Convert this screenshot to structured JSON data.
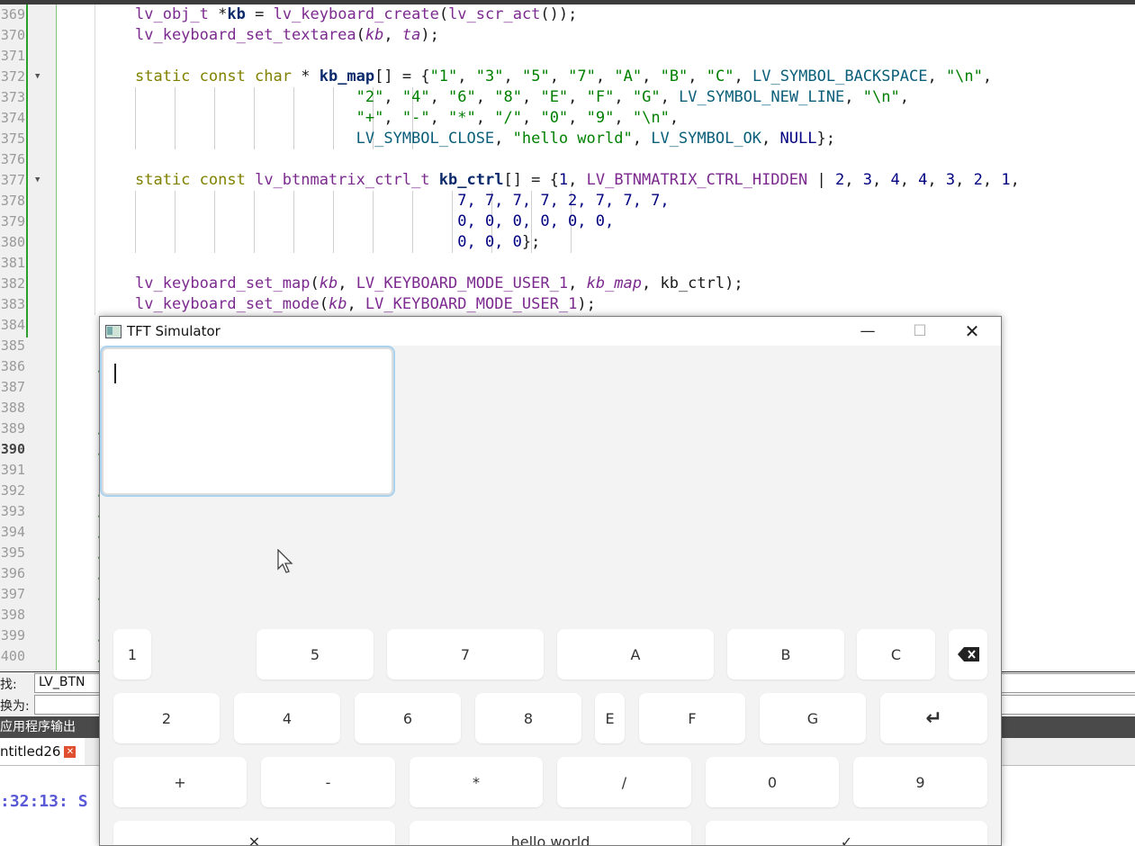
{
  "editor": {
    "line_numbers": [
      "369",
      "370",
      "371",
      "372",
      "373",
      "374",
      "375",
      "376",
      "377",
      "378",
      "379",
      "380",
      "381",
      "382",
      "383",
      "384",
      "385",
      "386",
      "387",
      "388",
      "389",
      "390",
      "391",
      "392",
      "393",
      "394",
      "395",
      "396",
      "397",
      "398",
      "399",
      "400"
    ],
    "current_line": "390",
    "fold_icon": "collapse-triangle"
  },
  "find": {
    "find_label": "找:",
    "find_value": "LV_BTN",
    "replace_label": "换为:"
  },
  "output": {
    "panel_title": "应用程序输出",
    "tab_label": "ntitled26",
    "text": ":32:13: S"
  },
  "simulator": {
    "title": "TFT Simulator",
    "min_icon": "minimize-icon",
    "max_icon": "maximize-icon",
    "close_icon": "close-icon",
    "keys": {
      "k1": "1",
      "k5": "5",
      "k7": "7",
      "kA": "A",
      "kB": "B",
      "kC": "C",
      "kbs": "⌫",
      "k2": "2",
      "k4": "4",
      "k6": "6",
      "k8": "8",
      "kE": "E",
      "kF": "F",
      "kG": "G",
      "knl": "↵",
      "kplus": "+",
      "kminus": "-",
      "kstar": "*",
      "kslash": "/",
      "k0": "0",
      "k9": "9",
      "kclose": "✕",
      "khello": "hello world",
      "kok": "✓"
    }
  },
  "colors": {
    "accent_focus": "#a9d3f1",
    "sim_bg": "#f3f3f3"
  }
}
